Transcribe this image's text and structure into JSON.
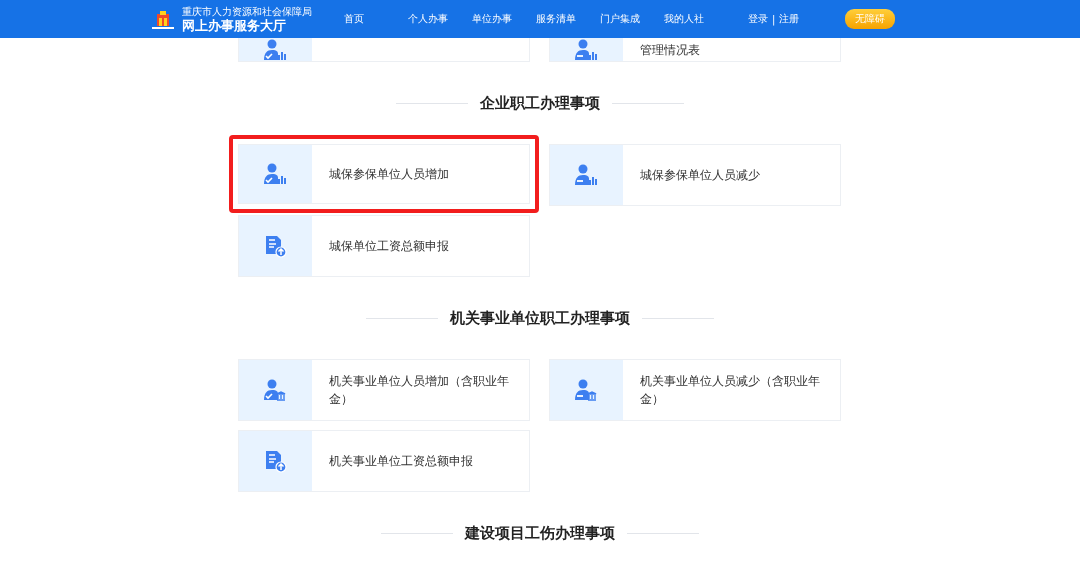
{
  "header": {
    "org_name": "重庆市人力资源和社会保障局",
    "site_title": "网上办事服务大厅",
    "nav": [
      {
        "label": "首页"
      },
      {
        "label": "个人办事"
      },
      {
        "label": "单位办事"
      },
      {
        "label": "服务清单"
      },
      {
        "label": "门户集成"
      },
      {
        "label": "我的人社"
      }
    ],
    "login": "登录",
    "separator": "|",
    "register": "注册",
    "accessibility_button": "无障碍"
  },
  "top_cards": [
    {
      "kind": "icon_only"
    },
    {
      "kind": "text",
      "title": "管理情况表"
    }
  ],
  "sections": [
    {
      "title": "企业职工办理事项",
      "items": [
        {
          "title": "城保参保单位人员增加",
          "highlighted": true
        },
        {
          "title": "城保参保单位人员减少",
          "highlighted": false
        },
        {
          "title": "城保单位工资总额申报",
          "highlighted": false
        }
      ]
    },
    {
      "title": "机关事业单位职工办理事项",
      "items": [
        {
          "title": "机关事业单位人员增加（含职业年金）",
          "highlighted": false
        },
        {
          "title": "机关事业单位人员减少（含职业年金）",
          "highlighted": false
        },
        {
          "title": "机关事业单位工资总额申报",
          "highlighted": false
        }
      ]
    },
    {
      "title": "建设项目工伤办理事项"
    }
  ]
}
